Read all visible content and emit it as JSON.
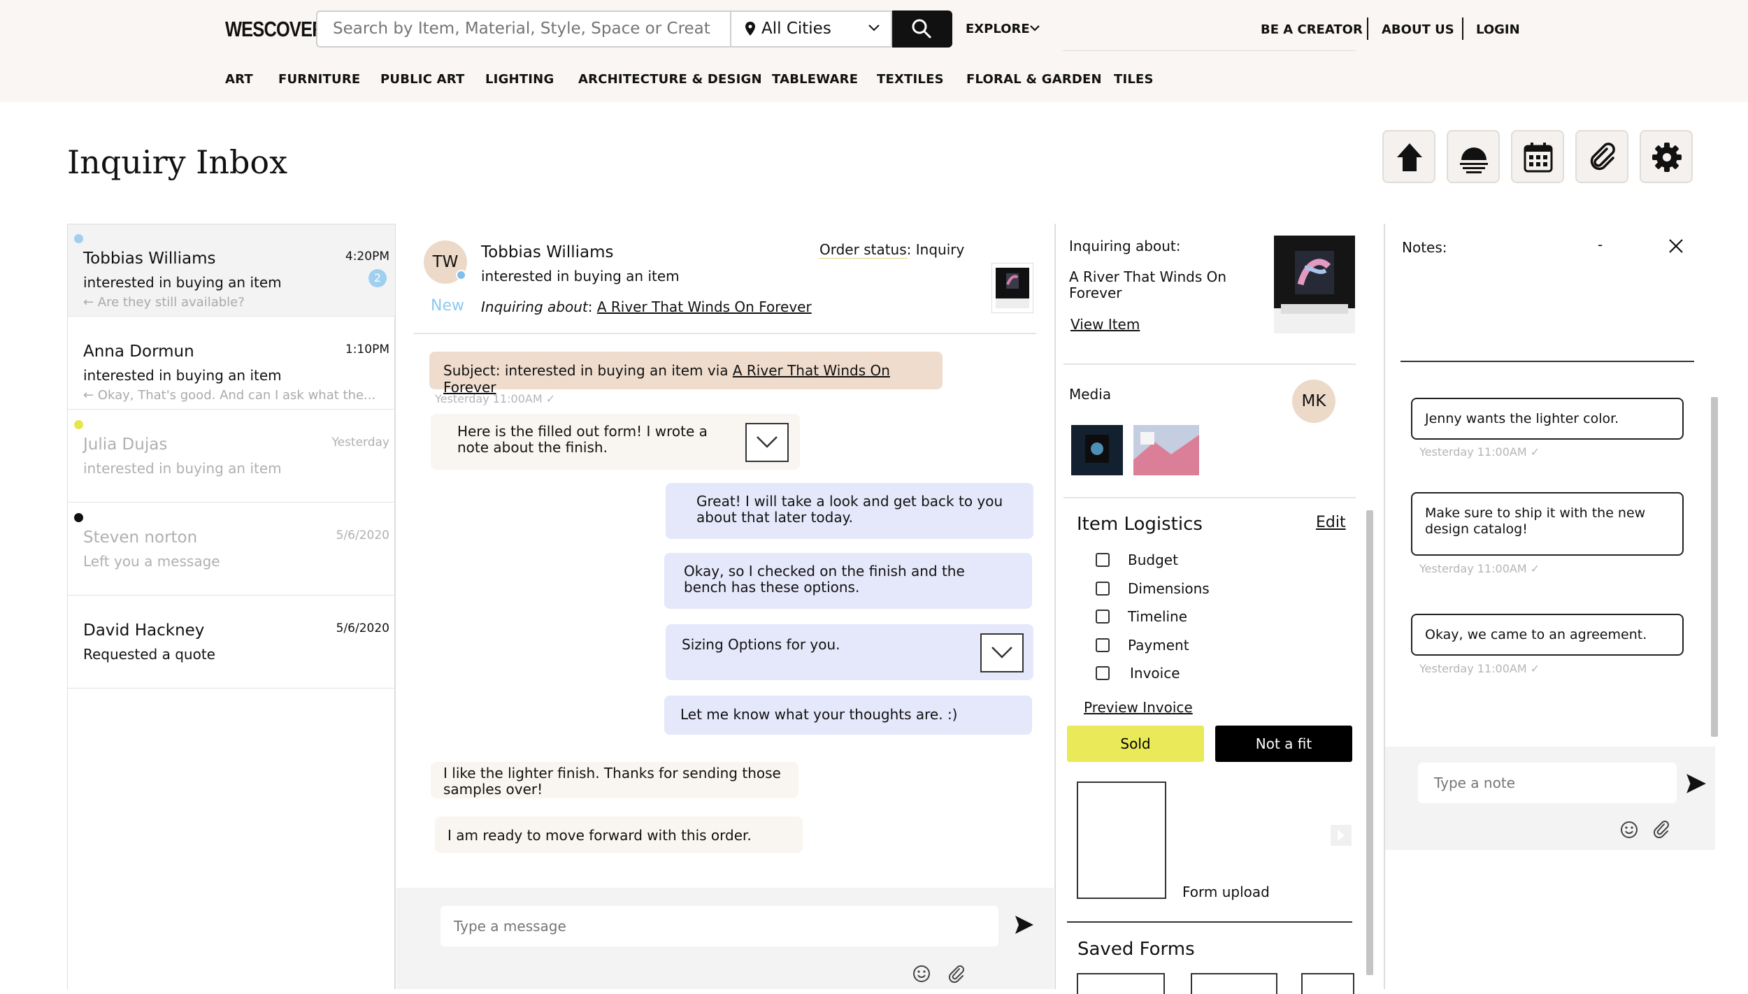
{
  "header": {
    "logo": "WESCOVER",
    "search_placeholder": "Search by Item, Material, Style, Space or Creator",
    "city": "All Cities",
    "explore": "EXPLORE",
    "links": [
      "BE A CREATOR",
      "ABOUT US",
      "LOGIN"
    ],
    "categories": [
      "ART",
      "FURNITURE",
      "PUBLIC ART",
      "LIGHTING",
      "ARCHITECTURE & DESIGN",
      "TABLEWARE",
      "TEXTILES",
      "FLORAL & GARDEN",
      "TILES"
    ]
  },
  "page": {
    "title": "Inquiry Inbox",
    "tools": [
      "home-icon",
      "sunset-icon",
      "calendar-icon",
      "paperclip-icon",
      "gear-icon"
    ]
  },
  "conversations": [
    {
      "name": "Tobbias Williams",
      "time": "4:20PM",
      "subtitle": "interested in buying an item",
      "preview": "← Are they still available?",
      "badge": "2",
      "dot_color": "#9fd0ef"
    },
    {
      "name": "Anna Dormun",
      "time": "1:10PM",
      "subtitle": "interested in buying an item",
      "preview": "← Okay, That's good. And can I ask what the..."
    },
    {
      "name": "Julia Dujas",
      "time": "Yesterday",
      "subtitle": "interested in buying an item",
      "dot_color": "#e6e64a"
    },
    {
      "name": "Steven norton",
      "time": "5/6/2020",
      "subtitle": "Left you a message",
      "dot_color": "#111111"
    },
    {
      "name": "David Hackney",
      "time": "5/6/2020",
      "subtitle": "Requested a quote"
    }
  ],
  "chat": {
    "initials": "TW",
    "status_tag": "New",
    "name": "Tobbias Williams",
    "subtitle": "interested in buying an item",
    "inquiring_label": "Inquiring about",
    "inquiring_item": "A River That Winds On Forever",
    "order_status_label": "Order status",
    "order_status": "Inquiry",
    "subject_prefix": "Subject: interested in buying an item via ",
    "subject_item": "A River That Winds On Forever",
    "subject_meta": "Yesterday 11:00AM",
    "messages": [
      {
        "dir": "in",
        "text": "Here is the filled out form! I wrote a note about the finish."
      },
      {
        "dir": "out",
        "text": "Great! I will take a look and get back to you about that later today."
      },
      {
        "dir": "out",
        "text": "Okay, so I checked on the finish and the bench has these options."
      },
      {
        "dir": "out",
        "text": "Sizing Options for you."
      },
      {
        "dir": "out",
        "text": "Let me know what your thoughts are. :)"
      },
      {
        "dir": "in",
        "text": "I like the lighter finish. Thanks for sending those samples over!"
      },
      {
        "dir": "in",
        "text": "I am ready to move forward with this order."
      }
    ],
    "composer_placeholder": "Type a message"
  },
  "details": {
    "inquiring_about_label": "Inquiring about:",
    "item_title": "A River That Winds On Forever",
    "view_item": "View Item",
    "media_label": "Media",
    "media_avatar": "MK",
    "logistics_title": "Item Logistics",
    "edit": "Edit",
    "logistics": [
      "Budget",
      "Dimensions",
      "Timeline",
      "Payment",
      "Invoice"
    ],
    "preview_invoice": "Preview Invoice",
    "sold": "Sold",
    "not_a_fit": "Not a fit",
    "form_upload": "Form upload",
    "saved_forms": "Saved Forms",
    "colors": {
      "sold": "#e9e95a",
      "not_fit": "#000000"
    }
  },
  "notes": {
    "label": "Notes:",
    "minimize": "-",
    "items": [
      {
        "text": "Jenny wants the lighter color.",
        "meta": "Yesterday 11:00AM"
      },
      {
        "text": "Make sure to ship it with the new design catalog!",
        "meta": "Yesterday 11:00AM"
      },
      {
        "text": "Okay, we came to an agreement.",
        "meta": "Yesterday 11:00AM"
      }
    ],
    "composer_placeholder": "Type a note"
  }
}
